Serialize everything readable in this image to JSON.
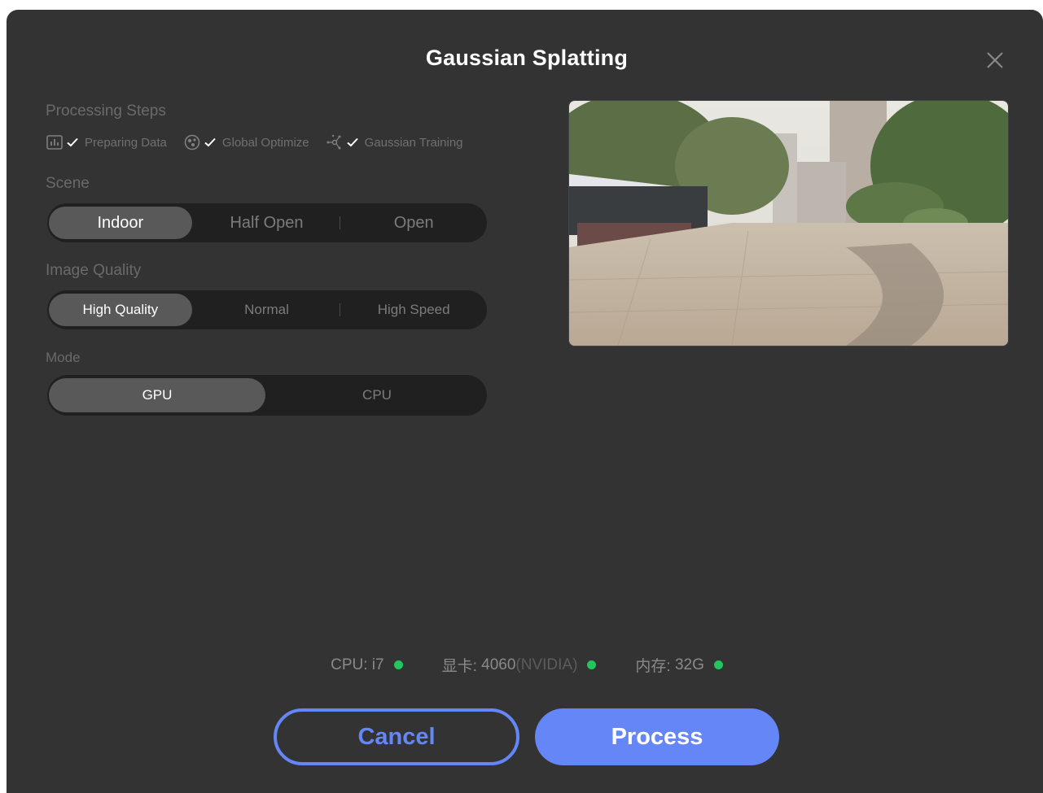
{
  "dialog": {
    "title": "Gaussian Splatting"
  },
  "processing_steps": {
    "label": "Processing Steps",
    "items": [
      {
        "icon": "bar-chart-icon",
        "checked": true,
        "label": "Preparing Data"
      },
      {
        "icon": "globe-icon",
        "checked": true,
        "label": "Global Optimize"
      },
      {
        "icon": "network-nodes-icon",
        "checked": true,
        "label": "Gaussian Training"
      }
    ]
  },
  "scene": {
    "label": "Scene",
    "options": [
      "Indoor",
      "Half Open",
      "Open"
    ],
    "selected": "Indoor"
  },
  "image_quality": {
    "label": "Image Quality",
    "options": [
      "High Quality",
      "Normal",
      "High Speed"
    ],
    "selected": "High Quality"
  },
  "mode": {
    "label": "Mode",
    "options": [
      "GPU",
      "CPU"
    ],
    "selected": "GPU"
  },
  "status": {
    "cpu": {
      "label": "CPU:",
      "value": "i7"
    },
    "gpu": {
      "label": "显卡:",
      "value": "4060",
      "sub": "(NVIDIA)"
    },
    "memory": {
      "label": "内存:",
      "value": "32G"
    },
    "ok_color": "#22c55e"
  },
  "buttons": {
    "cancel": "Cancel",
    "process": "Process"
  },
  "colors": {
    "accent": "#6586f7",
    "dialog_bg": "#333333"
  }
}
